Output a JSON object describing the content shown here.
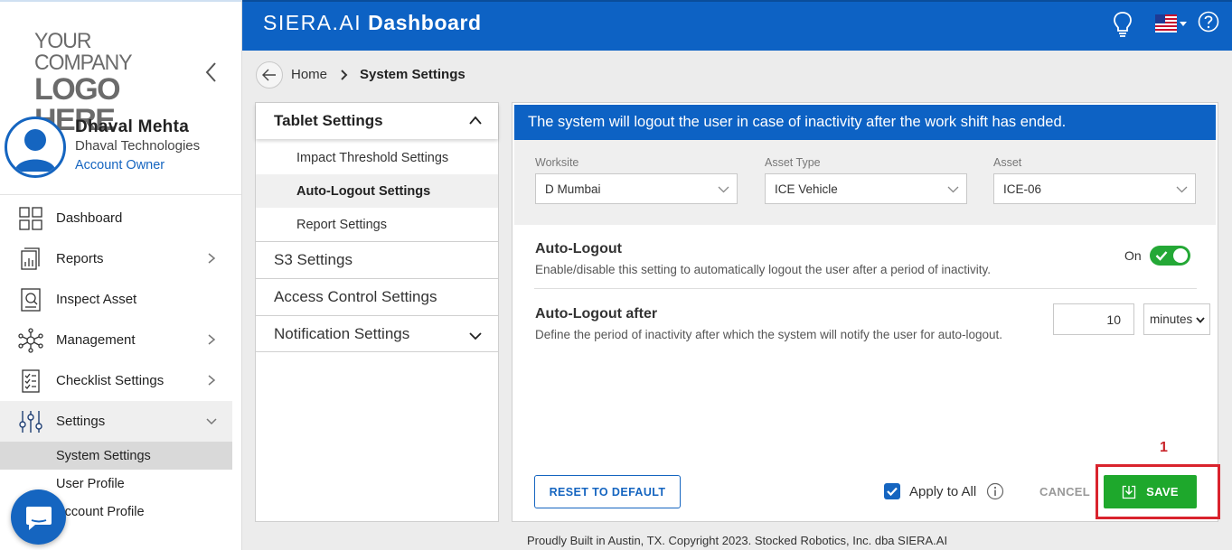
{
  "logo": {
    "line1": "YOUR COMPANY",
    "line2": "LOGO HERE"
  },
  "user": {
    "name": "Dhaval Mehta",
    "company": "Dhaval Technologies",
    "role": "Account Owner"
  },
  "nav": {
    "items": [
      {
        "label": "Dashboard",
        "icon": "grid-icon"
      },
      {
        "label": "Reports",
        "icon": "reports-icon"
      },
      {
        "label": "Inspect Asset",
        "icon": "inspect-icon"
      },
      {
        "label": "Management",
        "icon": "network-icon"
      },
      {
        "label": "Checklist Settings",
        "icon": "checklist-icon"
      },
      {
        "label": "Settings",
        "icon": "sliders-icon"
      }
    ],
    "sub_items": [
      "System Settings",
      "User Profile",
      "Account Profile"
    ]
  },
  "header": {
    "brand_prefix": "SIERA.AI",
    "brand_suffix": " Dashboard"
  },
  "breadcrumb": {
    "home": "Home",
    "current": "System Settings"
  },
  "settings_menu": {
    "header": "Tablet Settings",
    "sub_items": [
      "Impact Threshold Settings",
      "Auto-Logout Settings",
      "Report Settings"
    ],
    "sections": [
      "S3 Settings",
      "Access Control Settings",
      "Notification Settings"
    ]
  },
  "content": {
    "banner": "The system will logout the user in case of inactivity after the work shift has ended.",
    "filters": {
      "worksite": {
        "label": "Worksite",
        "value": "D Mumbai"
      },
      "asset_type": {
        "label": "Asset Type",
        "value": "ICE Vehicle"
      },
      "asset": {
        "label": "Asset",
        "value": "ICE-06"
      }
    },
    "auto_logout": {
      "title": "Auto-Logout",
      "desc": "Enable/disable this setting to automatically logout the user after a period of inactivity.",
      "toggle_label": "On"
    },
    "auto_logout_after": {
      "title": "Auto-Logout after",
      "desc": "Define the period of inactivity after which the system will notify the user for auto-logout.",
      "value": "10",
      "unit": "minutes"
    },
    "buttons": {
      "reset": "RESET TO DEFAULT",
      "apply_all": "Apply to All",
      "cancel": "CANCEL",
      "save": "SAVE"
    }
  },
  "annotation": {
    "number": "1"
  },
  "footer": "Proudly Built in Austin, TX. Copyright 2023. Stocked Robotics, Inc. dba SIERA.AI",
  "colors": {
    "primary": "#0d62c4",
    "success": "#1ea82c",
    "annotation": "#d9232d"
  }
}
